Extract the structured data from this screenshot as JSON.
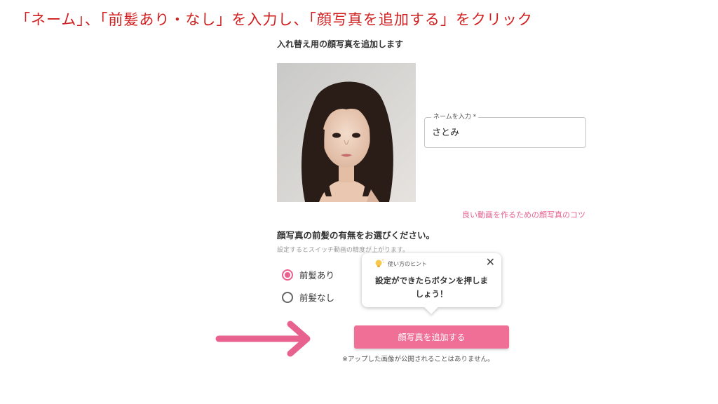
{
  "instruction": "「ネーム」、「前髪あり・なし」を入力し、「顔写真を追加する」をクリック",
  "upload": {
    "title": "入れ替え用の顔写真を追加します",
    "tips_link": "良い動画を作るための顔写真のコツ"
  },
  "name_field": {
    "label": "ネームを入力 *",
    "value": "さとみ"
  },
  "bangs": {
    "title": "顔写真の前髪の有無をお選びください。",
    "subtitle": "設定するとスイッチ動画の精度が上がります。",
    "options": [
      {
        "label": "前髪あり",
        "selected": true
      },
      {
        "label": "前髪なし",
        "selected": false
      }
    ]
  },
  "tooltip": {
    "icon": "lightbulb-icon",
    "header": "使い方のヒント",
    "close": "✕",
    "body": "設定ができたらボタンを押しましょう！"
  },
  "actions": {
    "add_photo_label": "顔写真を追加する",
    "note": "※アップした画像が公開されることはありません。"
  },
  "colors": {
    "accent": "#ef6f97",
    "instruction_red": "#d11f1f"
  }
}
